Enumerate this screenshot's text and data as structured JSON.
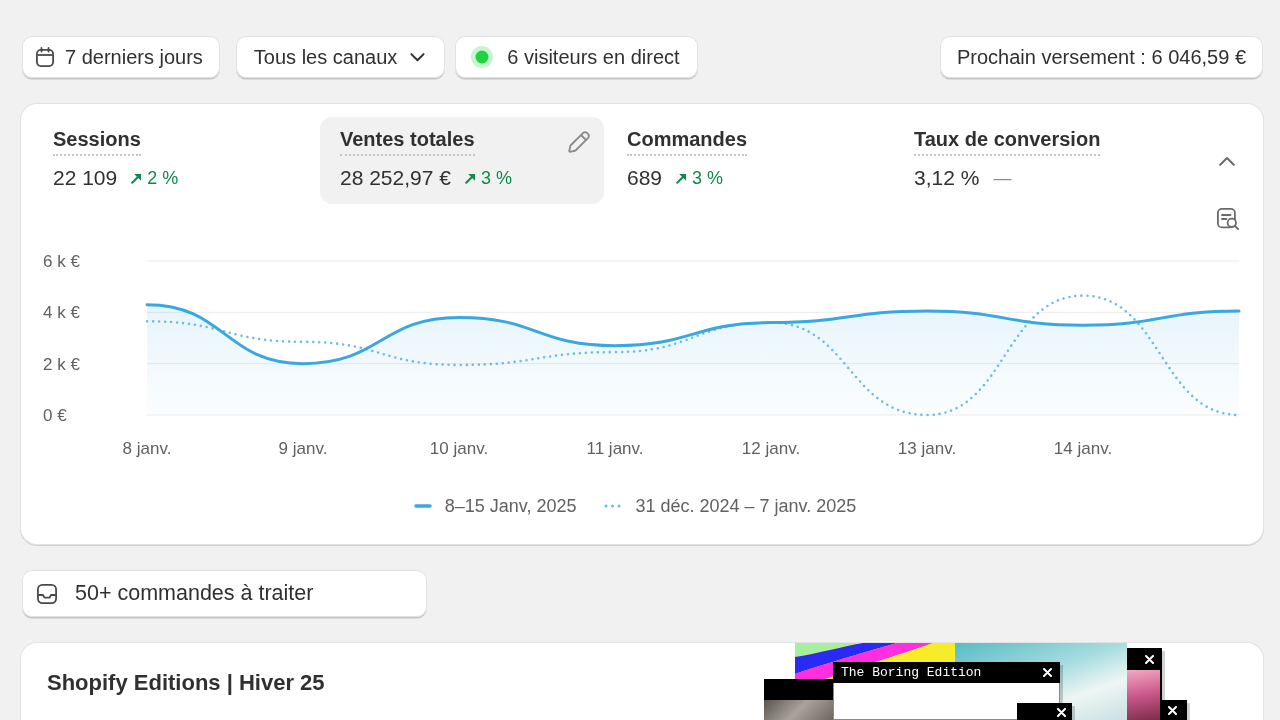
{
  "toolbar": {
    "filters": [
      {
        "kind": "date",
        "label": "7 derniers jours"
      },
      {
        "kind": "dropdown",
        "label": "Tous les canaux"
      },
      {
        "kind": "live",
        "label": "6 visiteurs en direct"
      }
    ],
    "payout": {
      "label": "Prochain versement : 6 046,59 €"
    }
  },
  "metrics": [
    {
      "label": "Sessions",
      "value": "22 109",
      "kind": "up",
      "change": "2 %",
      "selected": false
    },
    {
      "label": "Ventes totales",
      "value": "28 252,97 €",
      "kind": "up",
      "change": "3 %",
      "selected": true
    },
    {
      "label": "Commandes",
      "value": "689",
      "kind": "up",
      "change": "3 %",
      "selected": false
    },
    {
      "label": "Taux de conversion",
      "value": "3,12 %",
      "kind": "flat",
      "change": "—",
      "selected": false
    }
  ],
  "chart": {
    "chart_data": {
      "type": "area",
      "categories": [
        "8 janv.",
        "9 janv.",
        "10 janv.",
        "11 janv.",
        "12 janv.",
        "13 janv.",
        "14 janv.",
        null
      ],
      "ylim": [
        0,
        6000
      ],
      "yticks": [
        {
          "value": 0,
          "label": "0 €"
        },
        {
          "value": 2000,
          "label": "2 k €"
        },
        {
          "value": 4000,
          "label": "4 k €"
        },
        {
          "value": 6000,
          "label": "6 k €"
        }
      ],
      "legend": true,
      "series": [
        {
          "name": "8–15 Janv, 2025",
          "color": "#3aa7e0",
          "line_style": "solid",
          "values": [
            4300,
            2000,
            3800,
            2700,
            3600,
            4050,
            3500,
            4050
          ]
        },
        {
          "name": "31 déc. 2024 – 7 janv. 2025",
          "color": "#6bbde3",
          "type": "line",
          "line_style": "dotted",
          "values": [
            3650,
            2850,
            1950,
            2450,
            3600,
            0,
            4650,
            0
          ]
        }
      ]
    }
  },
  "tasks": {
    "label": "50+ commandes à traiter"
  },
  "editions": {
    "title": "Shopify Editions | Hiver 25",
    "window_title": "The Boring Edition"
  }
}
